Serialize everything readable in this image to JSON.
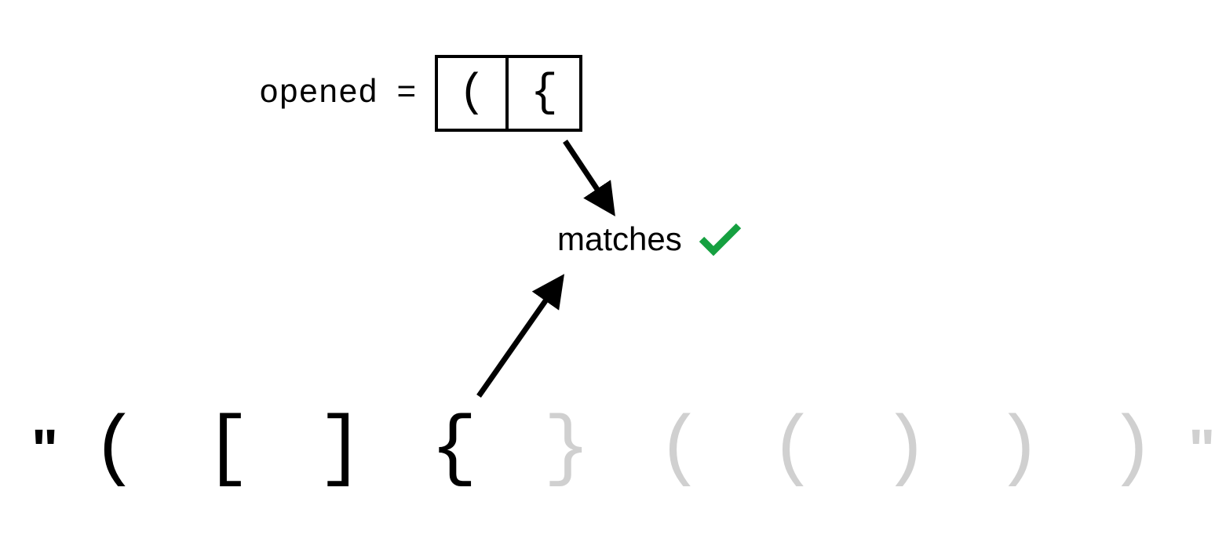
{
  "diagram": {
    "opened_label": "opened",
    "equals": "=",
    "stack": [
      "(",
      "{"
    ],
    "matches_label": "matches",
    "quote_left": "\"",
    "quote_right": "\"",
    "chars": [
      {
        "char": "(",
        "processed": true
      },
      {
        "char": "[",
        "processed": true
      },
      {
        "char": "]",
        "processed": true
      },
      {
        "char": "{",
        "processed": true
      },
      {
        "char": "}",
        "processed": false
      },
      {
        "char": "(",
        "processed": false
      },
      {
        "char": "(",
        "processed": false
      },
      {
        "char": ")",
        "processed": false
      },
      {
        "char": ")",
        "processed": false
      },
      {
        "char": ")",
        "processed": false
      }
    ],
    "current_index": 3,
    "check_color": "#15a040"
  }
}
